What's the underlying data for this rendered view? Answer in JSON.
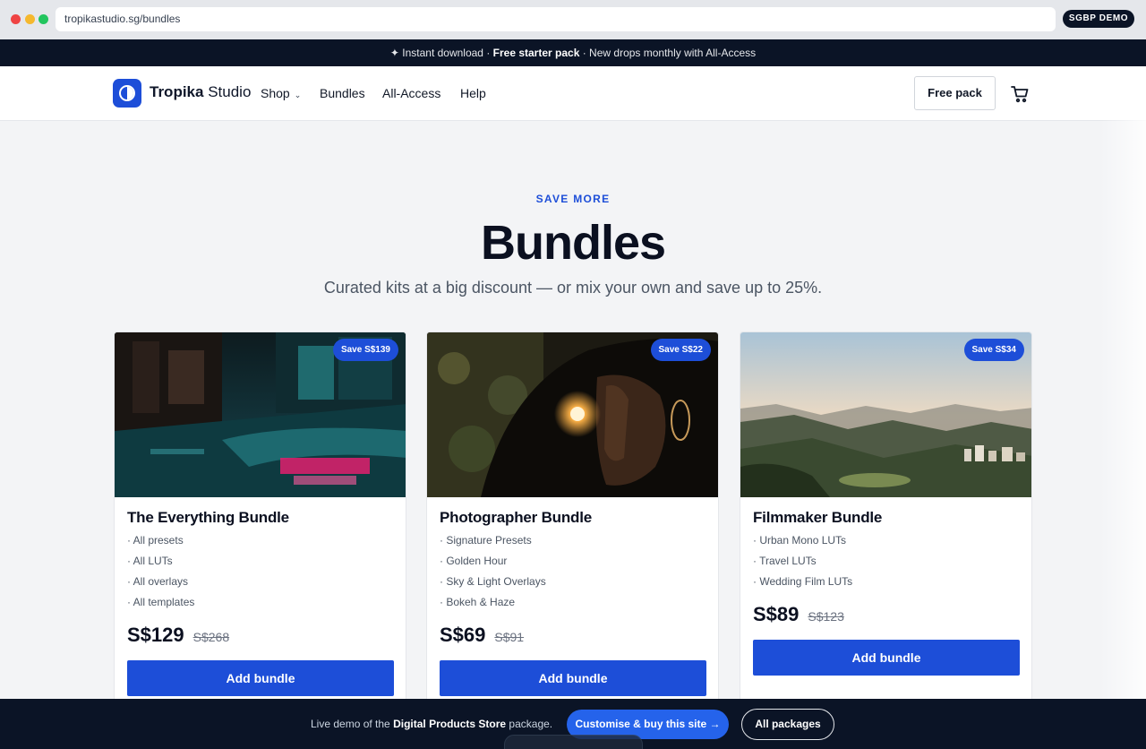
{
  "browser": {
    "url": "tropikastudio.sg/bundles",
    "badge": "SGBP DEMO"
  },
  "promo": {
    "part1": "✦ Instant download · ",
    "bold": "Free starter pack",
    "part2": " · New drops monthly with All-Access"
  },
  "header": {
    "brand_bold": "Tropika",
    "brand_rest": " Studio",
    "nav": [
      {
        "label": "Shop",
        "has_dropdown": true
      },
      {
        "label": "Bundles"
      },
      {
        "label": "All-Access"
      },
      {
        "label": "Help"
      }
    ],
    "free_pack_label": "Free pack",
    "cart_icon": "cart-icon"
  },
  "hero": {
    "eyebrow": "SAVE MORE",
    "title": "Bundles",
    "subtitle": "Curated kits at a big discount — or mix your own and save up to 25%."
  },
  "bundles": [
    {
      "name": "The Everything Bundle",
      "save": "Save S$139",
      "items": [
        "· All presets",
        "· All LUTs",
        "· All overlays",
        "· All templates"
      ],
      "price": "S$129",
      "was": "S$268",
      "button": "Add bundle",
      "image": "night street with neon reflections"
    },
    {
      "name": "Photographer Bundle",
      "save": "Save S$22",
      "items": [
        "· Signature Presets",
        "· Golden Hour",
        "· Sky & Light Overlays",
        "· Bokeh & Haze"
      ],
      "price": "S$69",
      "was": "S$91",
      "button": "Add bundle",
      "image": "backlit portrait with sun flare"
    },
    {
      "name": "Filmmaker Bundle",
      "save": "Save S$34",
      "items": [
        "· Urban Mono LUTs",
        "· Travel LUTs",
        "· Wedding Film LUTs"
      ],
      "price": "S$89",
      "was": "S$123",
      "button": "Add bundle",
      "image": "mountain valley landscape at sunset"
    }
  ],
  "bottom_bar": {
    "live_prefix": "Live demo of the ",
    "live_bold": "Digital Products Store",
    "live_suffix": " package.",
    "customise_label": "Customise & buy this site →",
    "all_packages_label": "All packages"
  },
  "colors": {
    "accent": "#1d4ed8",
    "dark": "#0b1426",
    "background": "#f3f4f6"
  }
}
